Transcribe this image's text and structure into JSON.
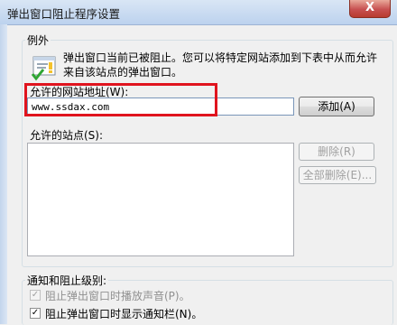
{
  "window": {
    "title": "弹出窗口阻止程序设置",
    "close_glyph": "X"
  },
  "exceptions": {
    "group_label": "例外",
    "description": "弹出窗口当前已被阻止。您可以将特定网站添加到下表中从而允许来自该站点的弹出窗口。",
    "address_label": "允许的网站地址(W):",
    "address_value": "www.ssdax.com",
    "add_button": "添加(A)",
    "allowed_sites_label": "允许的站点(S):",
    "remove_button": "删除(R)",
    "remove_all_button": "全部删除(E)...",
    "allowed_sites": []
  },
  "notifications": {
    "group_label": "通知和阻止级别:",
    "play_sound_label": "阻止弹出窗口时播放声音(P)。",
    "play_sound_checked": true,
    "show_bar_label": "阻止弹出窗口时显示通知栏(N)。",
    "show_bar_checked": true
  },
  "colors": {
    "highlight": "#e0141e",
    "close_button": "#c75050"
  },
  "icons": {
    "info": "popup-shield-check-icon",
    "close": "close-icon"
  }
}
